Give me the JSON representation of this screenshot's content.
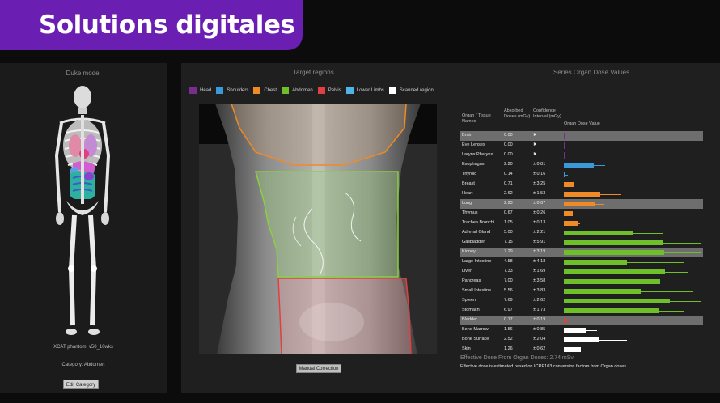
{
  "banner": {
    "title": "Solutions digitales"
  },
  "left_panel": {
    "title": "Duke model",
    "phantom_label": "XCAT phantom: v50_10wks",
    "category_label": "Category: Abdomen",
    "edit_button": "Edit Category"
  },
  "target": {
    "title": "Target regions",
    "legend": [
      {
        "label": "Head",
        "color": "#7b2d8e"
      },
      {
        "label": "Shoulders",
        "color": "#3a9ad9"
      },
      {
        "label": "Chest",
        "color": "#f08a24"
      },
      {
        "label": "Abdomen",
        "color": "#6fbf2a"
      },
      {
        "label": "Pelvis",
        "color": "#e04040"
      },
      {
        "label": "Lower Limbs",
        "color": "#4fb4e8"
      },
      {
        "label": "Scanned region",
        "color": "#ffffff"
      }
    ],
    "manual_button": "Manual Correction"
  },
  "series": {
    "title": "Series Organ Dose Values",
    "headers": {
      "organ": "Organ / Tissue Names",
      "dose": "Absorbed Doses (mGy)",
      "ci": "Confidence Interval (mGy)",
      "chart": "Organ Dose Value"
    },
    "rows": [
      {
        "name": "Brain",
        "dose": "0.00",
        "ci": "✖",
        "value": 0,
        "err": 0,
        "color": "#7b2d8e",
        "hl": true
      },
      {
        "name": "Eye Lenses",
        "dose": "0.00",
        "ci": "✖",
        "value": 0,
        "err": 0,
        "color": "#7b2d8e",
        "hl": false
      },
      {
        "name": "Larynx Pharynx",
        "dose": "0.00",
        "ci": "✖",
        "value": 0,
        "err": 0,
        "color": "#7b2d8e",
        "hl": false
      },
      {
        "name": "Esophagus",
        "dose": "2.20",
        "ci": "± 0.81",
        "value": 2.2,
        "err": 0.81,
        "color": "#3a9ad9",
        "hl": false
      },
      {
        "name": "Thyroid",
        "dose": "0.14",
        "ci": "± 0.16",
        "value": 0.14,
        "err": 0.16,
        "color": "#3a9ad9",
        "hl": false
      },
      {
        "name": "Breast",
        "dose": "0.71",
        "ci": "± 3.25",
        "value": 0.71,
        "err": 3.25,
        "color": "#f08a24",
        "hl": false
      },
      {
        "name": "Heart",
        "dose": "2.62",
        "ci": "± 1.53",
        "value": 2.62,
        "err": 1.53,
        "color": "#f08a24",
        "hl": false
      },
      {
        "name": "Lung",
        "dose": "2.23",
        "ci": "± 0.67",
        "value": 2.23,
        "err": 0.67,
        "color": "#f08a24",
        "hl": true
      },
      {
        "name": "Thymus",
        "dose": "0.67",
        "ci": "± 0.26",
        "value": 0.67,
        "err": 0.26,
        "color": "#f08a24",
        "hl": false
      },
      {
        "name": "Trachea Bronchi",
        "dose": "1.05",
        "ci": "± 0.13",
        "value": 1.05,
        "err": 0.13,
        "color": "#f08a24",
        "hl": false
      },
      {
        "name": "Adrenal Gland",
        "dose": "5.00",
        "ci": "± 2.21",
        "value": 5.0,
        "err": 2.21,
        "color": "#6fbf2a",
        "hl": false
      },
      {
        "name": "Gallbladder",
        "dose": "7.15",
        "ci": "± 5.91",
        "value": 7.15,
        "err": 5.91,
        "color": "#6fbf2a",
        "hl": false
      },
      {
        "name": "Kidney",
        "dose": "7.29",
        "ci": "± 3.19",
        "value": 7.29,
        "err": 3.19,
        "color": "#6fbf2a",
        "hl": true
      },
      {
        "name": "Large Intestine",
        "dose": "4.58",
        "ci": "± 4.18",
        "value": 4.58,
        "err": 4.18,
        "color": "#6fbf2a",
        "hl": false
      },
      {
        "name": "Liver",
        "dose": "7.33",
        "ci": "± 1.69",
        "value": 7.33,
        "err": 1.69,
        "color": "#6fbf2a",
        "hl": false
      },
      {
        "name": "Pancreas",
        "dose": "7.00",
        "ci": "± 3.58",
        "value": 7.0,
        "err": 3.58,
        "color": "#6fbf2a",
        "hl": false
      },
      {
        "name": "Small Intestine",
        "dose": "5.56",
        "ci": "± 3.83",
        "value": 5.56,
        "err": 3.83,
        "color": "#6fbf2a",
        "hl": false
      },
      {
        "name": "Spleen",
        "dose": "7.69",
        "ci": "± 2.62",
        "value": 7.69,
        "err": 2.62,
        "color": "#6fbf2a",
        "hl": false
      },
      {
        "name": "Stomach",
        "dose": "6.97",
        "ci": "± 1.73",
        "value": 6.97,
        "err": 1.73,
        "color": "#6fbf2a",
        "hl": false
      },
      {
        "name": "Bladder",
        "dose": "0.17",
        "ci": "± 0.19",
        "value": 0.17,
        "err": 0.19,
        "color": "#e04040",
        "hl": true
      },
      {
        "name": "Bone Marrow",
        "dose": "1.56",
        "ci": "± 0.85",
        "value": 1.56,
        "err": 0.85,
        "color": "#ffffff",
        "hl": false
      },
      {
        "name": "Bone Surface",
        "dose": "2.52",
        "ci": "± 2.04",
        "value": 2.52,
        "err": 2.04,
        "color": "#ffffff",
        "hl": false
      },
      {
        "name": "Skin",
        "dose": "1.26",
        "ci": "± 0.62",
        "value": 1.26,
        "err": 0.62,
        "color": "#ffffff",
        "hl": false
      }
    ],
    "chart_max": 10,
    "effective_title": "Effective Dose From Organ Doses: 2.74 mSv",
    "effective_note": "Effective dose is estimated based on ICRP103 conversion factors from Organ doses"
  }
}
